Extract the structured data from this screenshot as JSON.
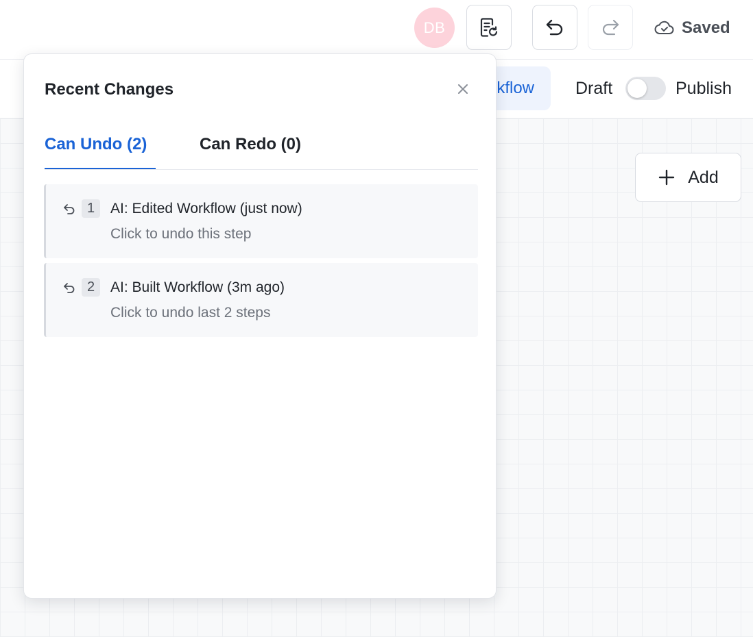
{
  "header": {
    "avatar_initials": "DB",
    "status_label": "Saved"
  },
  "subbar": {
    "workflow_tab_label": "Workflow",
    "workflow_tab_visible": "kflow",
    "draft_label": "Draft",
    "publish_label": "Publish",
    "toggle_state": "off"
  },
  "canvas": {
    "add_label": "Add"
  },
  "panel": {
    "title": "Recent Changes",
    "tabs": [
      {
        "label": "Can Undo (2)",
        "active": true
      },
      {
        "label": "Can Redo (0)",
        "active": false
      }
    ],
    "items": [
      {
        "number": "1",
        "title": "AI: Edited Workflow (just now)",
        "subtitle": "Click to undo this step"
      },
      {
        "number": "2",
        "title": "AI: Built Workflow (3m ago)",
        "subtitle": "Click to undo last 2 steps"
      }
    ]
  },
  "colors": {
    "accent": "#1a63d6",
    "avatar_bg": "#fdd3db",
    "workflow_tab_bg": "#eef3fd"
  },
  "icons": {
    "history": "file-history-icon",
    "undo": "undo-icon",
    "redo": "redo-icon",
    "saved": "cloud-check-icon",
    "close": "close-icon",
    "add": "plus-icon",
    "item_undo": "undo-small-icon"
  }
}
